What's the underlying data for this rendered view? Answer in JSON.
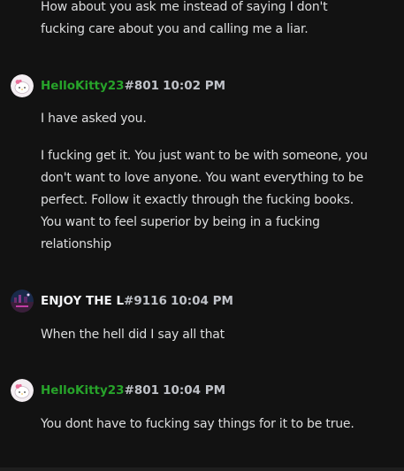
{
  "messages": [
    {
      "lines": [
        "How about you ask me instead of saying I don't",
        "fucking care about you and calling me a liar."
      ]
    },
    {
      "username": "HelloKitty23",
      "discriminator": "#801",
      "timestamp": "10:02 PM",
      "paragraphs": [
        [
          "I have asked you."
        ],
        [
          "I fucking get it. You just want to be with someone, you",
          "don't want to love anyone. You want everything to be",
          "perfect. Follow it exactly through the fucking books.",
          "You want to feel superior by being in a fucking",
          "relationship"
        ]
      ]
    },
    {
      "username": "ENJOY THE L",
      "discriminator": "#9116",
      "timestamp": "10:04 PM",
      "paragraphs": [
        [
          "When the hell did I say all that"
        ]
      ]
    },
    {
      "username": "HelloKitty23",
      "discriminator": "#801",
      "timestamp": "10:04 PM",
      "paragraphs": [
        [
          "You dont have to fucking say things for it to be true."
        ]
      ]
    }
  ],
  "avatars": {
    "hellokitty": "hello-kitty-avatar",
    "enjoy": "night-scene-avatar"
  },
  "colors": {
    "background": "#121212",
    "text": "#dcddde",
    "username_green": "#27a32a",
    "meta": "#bfc2c8"
  }
}
